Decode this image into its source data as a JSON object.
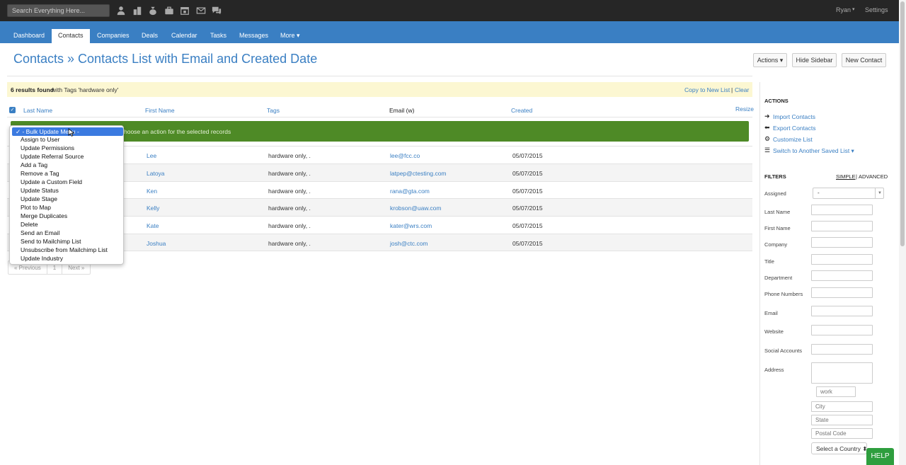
{
  "topbar": {
    "search_placeholder": "Search Everything Here...",
    "icons": [
      "person-icon",
      "buildings-icon",
      "money-bag-icon",
      "briefcase-icon",
      "calendar-icon",
      "envelope-icon",
      "chat-icon"
    ],
    "user": "Ryan",
    "user_caret": "▾",
    "settings": "Settings"
  },
  "nav": {
    "items": [
      "Dashboard",
      "Contacts",
      "Companies",
      "Deals",
      "Calendar",
      "Tasks",
      "Messages",
      "More ▾"
    ],
    "active": "Contacts"
  },
  "page": {
    "title": "Contacts » Contacts List with Email and Created Date",
    "buttons": {
      "actions": "Actions ▾",
      "hide_sidebar": "Hide Sidebar",
      "new_contact": "New Contact"
    }
  },
  "results": {
    "count": "6 results found",
    "text": "with Tags 'hardware only'",
    "copy_list": "Copy to New List",
    "separator": "|",
    "clear": "Clear"
  },
  "table": {
    "headers": [
      "Last Name",
      "First Name",
      "Tags",
      "Email (w)",
      "Created"
    ],
    "resize": "Resize",
    "bulk_hint": "Choose an action for the selected records",
    "bulk_hint_visible": "hoose an action for the selected records",
    "rows": [
      {
        "first": "Lee",
        "tags": "hardware only, .",
        "email": "lee@fcc.co",
        "created": "05/07/2015"
      },
      {
        "first": "Latoya",
        "tags": "hardware only, .",
        "email": "latpep@ctesting.com",
        "created": "05/07/2015"
      },
      {
        "first": "Ken",
        "tags": "hardware only, .",
        "email": "rana@gta.com",
        "created": "05/07/2015"
      },
      {
        "first": "Kelly",
        "tags": "hardware only, .",
        "email": "krobson@uaw.com",
        "created": "05/07/2015"
      },
      {
        "first": "Kate",
        "tags": "hardware only, .",
        "email": "kater@wrs.com",
        "created": "05/07/2015"
      },
      {
        "first": "Joshua",
        "tags": "hardware only, .",
        "email": "josh@ctc.com",
        "created": "05/07/2015"
      }
    ]
  },
  "pager": {
    "prev": "« Previous",
    "page": "1",
    "next": "Next »"
  },
  "bulk_menu": {
    "selected": "✓ - Bulk Update Menu -",
    "options": [
      "Assign to User",
      "Update Permissions",
      "Update Referral Source",
      "Add a Tag",
      "Remove a Tag",
      "Update a Custom Field",
      "Update Status",
      "Update Stage",
      "Plot to Map",
      "Merge Duplicates",
      "Delete",
      "Send an Email",
      "Send to Mailchimp List",
      "Unsubscribe from Mailchimp List",
      "Update Industry"
    ]
  },
  "sidebar": {
    "actions_title": "ACTIONS",
    "actions": [
      {
        "label": "Import Contacts",
        "icon": "arrow-right-icon",
        "glyph": "➜"
      },
      {
        "label": "Export Contacts",
        "icon": "arrow-left-icon",
        "glyph": "⬅"
      },
      {
        "label": "Customize List",
        "icon": "gear-icon",
        "glyph": "⚙"
      },
      {
        "label": "Switch to Another Saved List ▾",
        "icon": "list-icon",
        "glyph": "☰"
      }
    ],
    "filters_title": "FILTERS",
    "simple": "SIMPLE",
    "sep": "|",
    "advanced": "ADVANCED",
    "assigned_label": "Assigned",
    "assigned_value": "-",
    "fields": [
      "Last Name",
      "First Name",
      "Company",
      "Title",
      "Department",
      "Phone Numbers",
      "Email",
      "Website",
      "Social Accounts",
      "Address"
    ],
    "address_type": "work",
    "city_placeholder": "City",
    "state_placeholder": "State",
    "postal_placeholder": "Postal Code",
    "country": "Select a Country ⬍"
  },
  "help": "HELP",
  "colors": {
    "brand_blue": "#3a7fc3",
    "green_bar": "#4e8a26",
    "help_green": "#2e9e3e",
    "topbar": "#262626"
  }
}
